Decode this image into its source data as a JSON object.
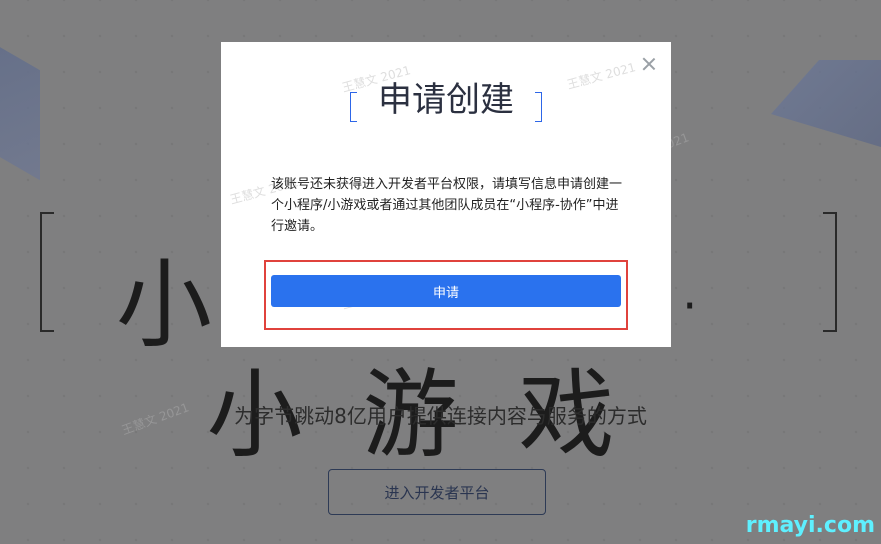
{
  "page": {
    "hero_title": "小程序 · 小游戏",
    "subtitle": "为字节跳动8亿用户提供连接内容与服务的方式",
    "enter_button": "进入开发者平台",
    "site_watermark": "rmayi.com",
    "watermark": "王慧文 2021"
  },
  "modal": {
    "title": "申请创建",
    "description": "该账号还未获得进入开发者平台权限，请填写信息申请创建一个小程序/小游戏或者通过其他团队成员在“小程序-协作”中进行邀请。",
    "apply_button": "申请",
    "close_icon": "close-icon"
  },
  "colors": {
    "primary": "#2a72ee",
    "highlight": "#e0423c",
    "overlay": "#7f7f80"
  }
}
